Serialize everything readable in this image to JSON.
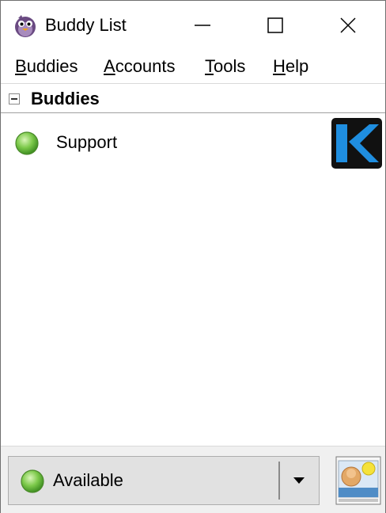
{
  "window": {
    "title": "Buddy List",
    "controls": {
      "minimize": "minimize",
      "maximize": "maximize",
      "close": "close"
    }
  },
  "menu": {
    "items": [
      {
        "mnemonic": "B",
        "rest": "uddies"
      },
      {
        "mnemonic": "A",
        "rest": "ccounts"
      },
      {
        "mnemonic": "T",
        "rest": "ools"
      },
      {
        "mnemonic": "H",
        "rest": "elp"
      }
    ]
  },
  "buddy_list": {
    "group": {
      "label": "Buddies",
      "expanded": true,
      "expander_icon": "collapse-minus-icon"
    },
    "buddies": [
      {
        "name": "Support",
        "status": "available",
        "status_icon": "green-status-dot-icon",
        "avatar_icon": "k-logo-icon"
      }
    ]
  },
  "status_selector": {
    "selected": "Available",
    "status_icon": "green-status-dot-icon",
    "dropdown_icon": "dropdown-arrow-icon",
    "account_icon": "buddy-icon-picture"
  },
  "colors": {
    "available": "#6cc04a",
    "k_logo_blue": "#1f8ee0",
    "k_logo_bg": "#111111",
    "window_border": "#707070"
  }
}
